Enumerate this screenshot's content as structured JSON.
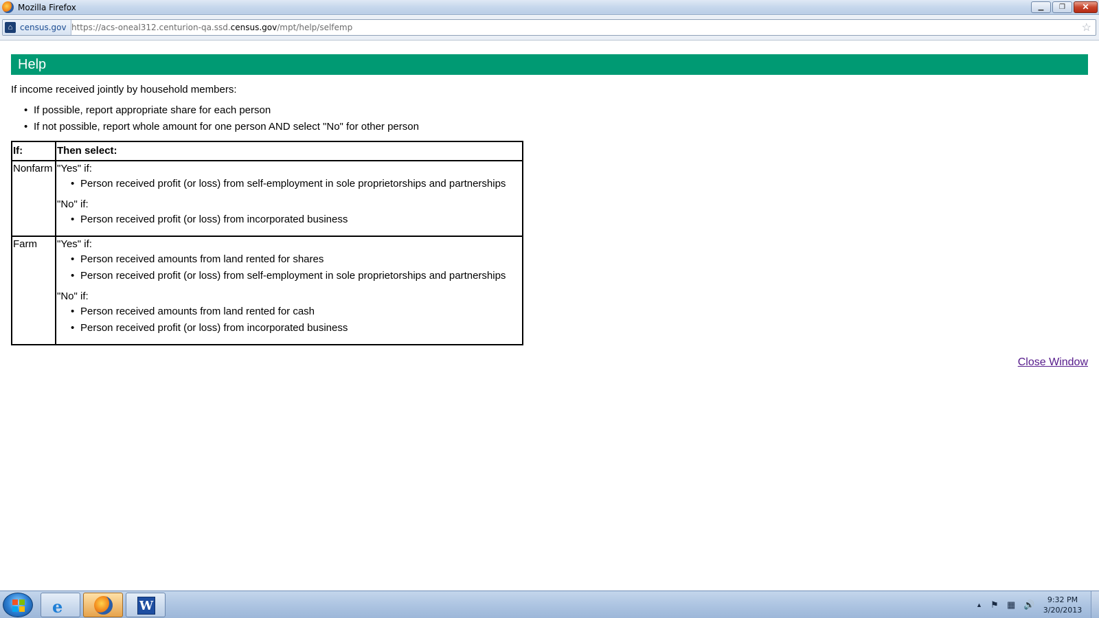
{
  "window": {
    "title": "Mozilla Firefox",
    "min_glyph": "▁",
    "max_glyph": "❐",
    "close_glyph": "✕"
  },
  "address_bar": {
    "site_identity": "census.gov",
    "url_prefix": "https://acs-oneal312.centurion-qa.ssd.",
    "url_domain": "census.gov",
    "url_path": "/mpt/help/selfemp"
  },
  "help": {
    "header": "Help",
    "intro": "If income received jointly by household members:",
    "intro_items": [
      "If possible, report appropriate share for each person",
      "If not possible, report whole amount for one person AND select \"No\" for other person"
    ],
    "table": {
      "col_if": "If:",
      "col_then": "Then select:",
      "rows": [
        {
          "label": "Nonfarm",
          "yes_label": "\"Yes\" if:",
          "yes_items": [
            "Person received profit (or loss) from self-employment in sole proprietorships and partnerships"
          ],
          "no_label": "\"No\" if:",
          "no_items": [
            "Person received profit (or loss) from incorporated business"
          ]
        },
        {
          "label": "Farm",
          "yes_label": "\"Yes\" if:",
          "yes_items": [
            "Person received amounts from land rented for shares",
            "Person received profit (or loss) from self-employment in sole proprietorships and partnerships"
          ],
          "no_label": "\"No\" if:",
          "no_items": [
            "Person received amounts from land rented for cash",
            "Person received profit (or loss) from incorporated business"
          ]
        }
      ]
    },
    "close_link": "Close Window"
  },
  "taskbar": {
    "word_letter": "W",
    "clock_time": "9:32 PM",
    "clock_date": "3/20/2013"
  },
  "colors": {
    "header_bg": "#009a73",
    "link_visited": "#551a8b"
  }
}
